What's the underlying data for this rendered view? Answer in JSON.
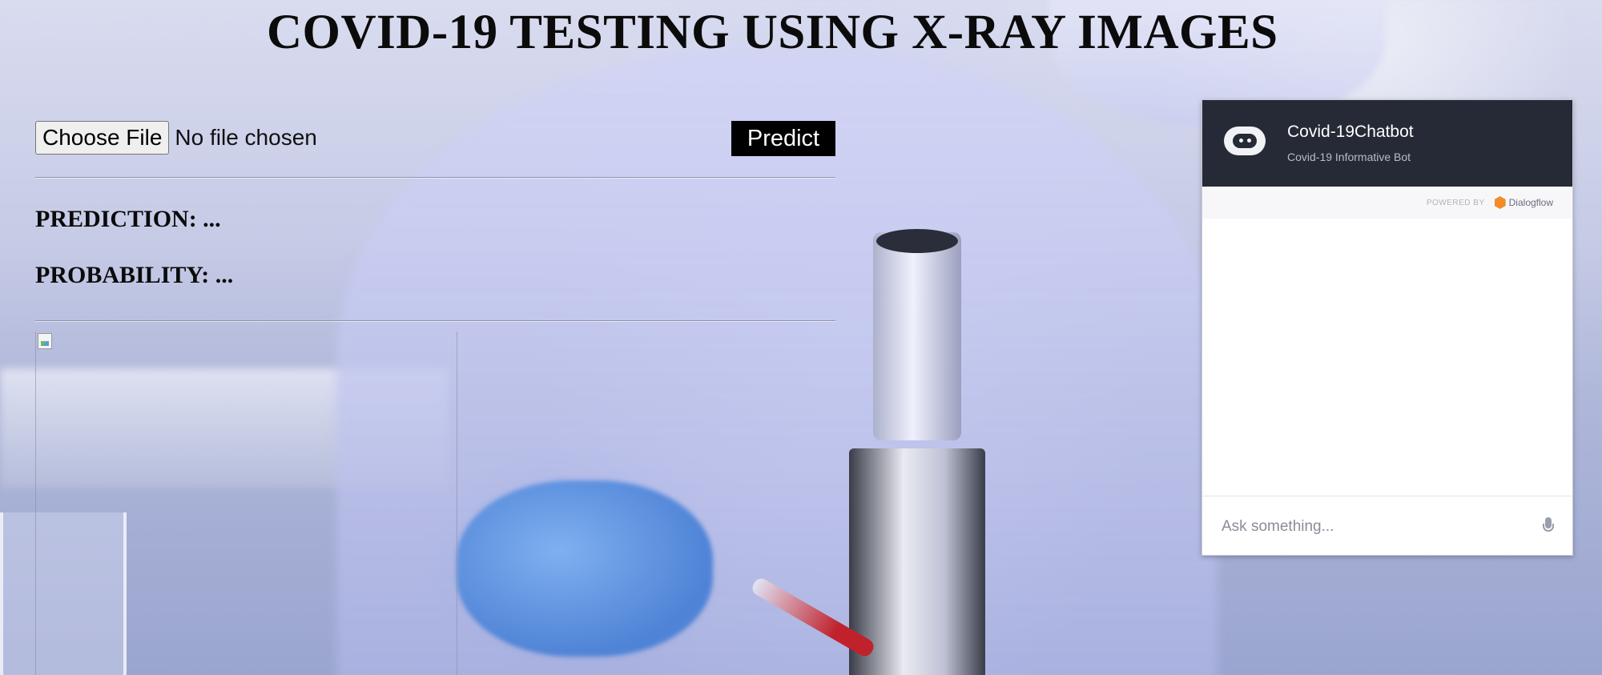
{
  "page": {
    "title": "COVID-19 TESTING USING X-RAY IMAGES"
  },
  "upload": {
    "choose_file_label": "Choose File",
    "file_status": "No file chosen",
    "predict_label": "Predict"
  },
  "results": {
    "prediction": "PREDICTION: ...",
    "probability": "PROBABILITY: ..."
  },
  "chatbot": {
    "title": "Covid-19Chatbot",
    "subtitle": "Covid-19 Informative Bot",
    "powered_by": "POWERED BY",
    "provider": "Dialogflow",
    "input_placeholder": "Ask something...",
    "avatar_icon": "robot-icon",
    "mic_icon": "microphone-icon"
  }
}
